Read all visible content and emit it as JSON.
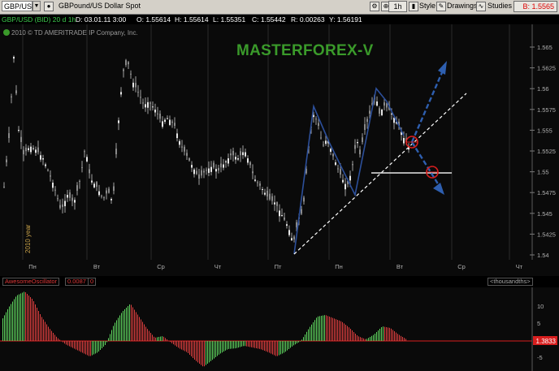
{
  "toolbar": {
    "symbol": "GBP/USD",
    "title": "GBPound/US Dollar Spot",
    "period": "1h",
    "style_label": "Style",
    "drawings_label": "Drawings",
    "studies_label": "Studies",
    "bid": "B: 1.5565"
  },
  "info": {
    "series": "GBP/USD (BID) 20 d 1h",
    "date": "D: 03.01.11 3:00",
    "open": "O: 1.55614",
    "high": "H: 1.55614",
    "low": "L: 1.55351",
    "close": "C: 1.55442",
    "range": "R: 0.00263",
    "y": "Y: 1.56191"
  },
  "chart": {
    "copyright": "2010 © TD AMERITRADE IP Company, Inc.",
    "watermark": "MASTERFOREX-V",
    "year_label": "2010 year",
    "price_ticks": [
      "1.565",
      "1.5625",
      "1.56",
      "1.5575",
      "1.555",
      "1.5525",
      "1.55",
      "1.5475",
      "1.545",
      "1.5425",
      "1.54"
    ],
    "day_labels": [
      "Пн",
      "Вт",
      "Ср",
      "Чт",
      "Пт",
      "Пн",
      "Вт",
      "Ср",
      "Чт"
    ],
    "colors": {
      "background": "#0a0a0a",
      "candle": "#c8c8c8",
      "grid": "#2a2a2a",
      "pattern": "#2c4f9a",
      "arrow": "#2e5fb0",
      "watermark": "#3a9a2a",
      "circle": "#d81e1e"
    }
  },
  "oscillator": {
    "name": "AwesomeOscillator",
    "value": "0.0087",
    "value2": "0",
    "units": "<thousandths>",
    "ticks": [
      "10",
      "5",
      "0",
      "-5"
    ],
    "current": "1.3833"
  }
}
